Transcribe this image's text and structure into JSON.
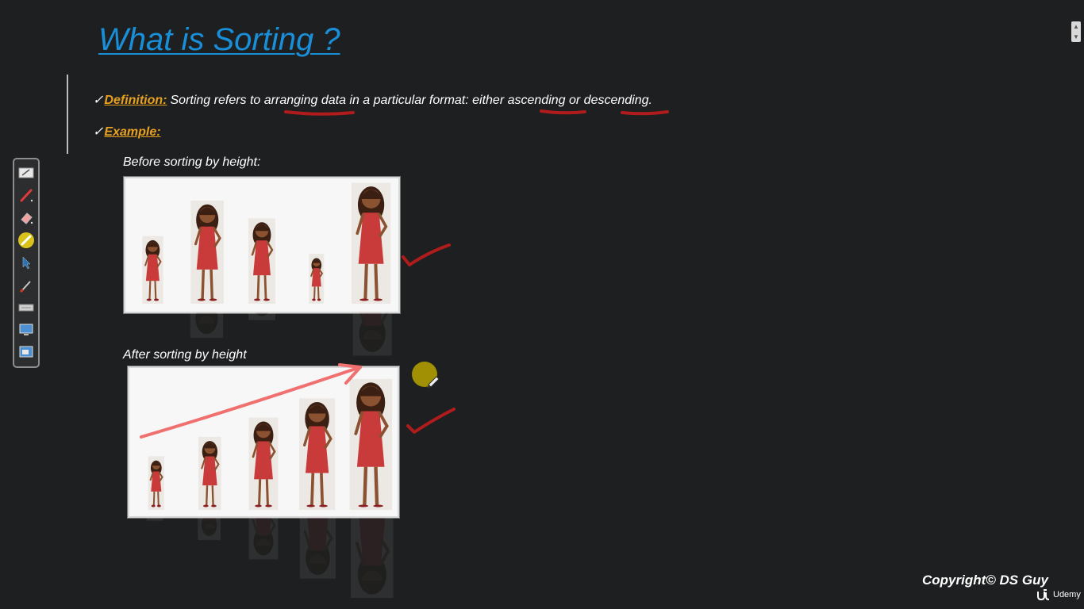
{
  "slide": {
    "title": "What is Sorting ?",
    "check_mark": "✓",
    "definition_label": "Definition:",
    "definition_text": "Sorting refers to arranging data in a particular format: either ascending or descending.",
    "example_label": "Example:",
    "before_caption": "Before sorting by height:",
    "after_caption": "After sorting by height",
    "copyright": "Copyright© DS Guy"
  },
  "figures": {
    "before_order": [
      2,
      4,
      3,
      1,
      5
    ],
    "after_order": [
      1,
      2,
      3,
      4,
      5
    ],
    "dress_color": "#c93a3a",
    "skin_color": "#8a5230",
    "hair_color": "#3a1f12"
  },
  "toolbar": {
    "tools": [
      "whiteboard-icon",
      "pen-icon",
      "eraser-icon",
      "highlighter-icon",
      "pointer-icon",
      "brush-icon",
      "keyboard-icon",
      "screen-icon",
      "window-icon"
    ]
  },
  "branding": {
    "logo_text": "Udemy"
  },
  "annotations": {
    "underline_color": "#b01c1c",
    "arrow_color": "#f07070",
    "check_color": "#b01c1c"
  }
}
